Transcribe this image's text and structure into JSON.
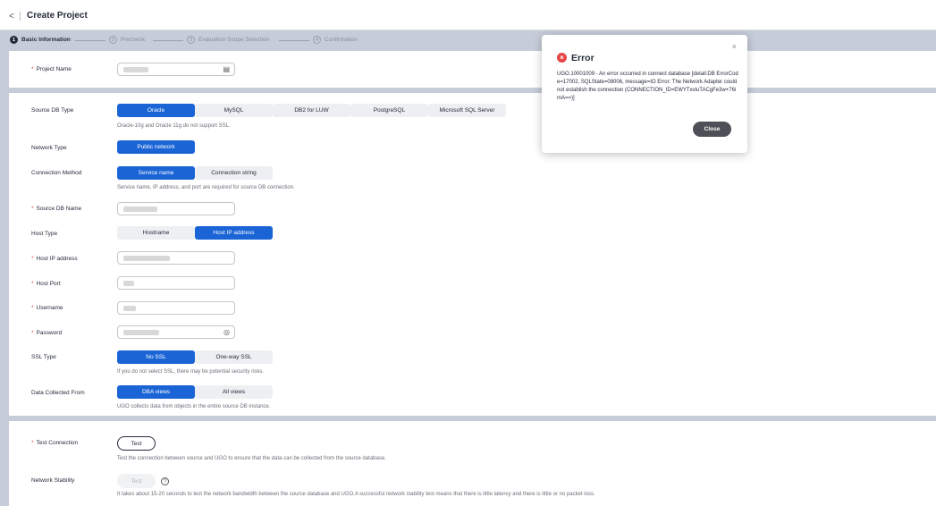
{
  "header": {
    "back_icon": "chevron-left-icon",
    "back_glyph": "<",
    "title": "Create Project"
  },
  "steps": [
    {
      "num": "1",
      "label": "Basic Information"
    },
    {
      "num": "2",
      "label": "Precheck"
    },
    {
      "num": "3",
      "label": "Evaluation Scope Selection"
    },
    {
      "num": "4",
      "label": "Confirmation"
    }
  ],
  "form": {
    "project_name_label": "Project Name",
    "source_db_type_label": "Source DB Type",
    "db_types": [
      "Oracle",
      "MySQL",
      "DB2 for LUW",
      "PostgreSQL",
      "Microsoft SQL Server"
    ],
    "db_type_selected": "Oracle",
    "db_type_hint": "Oracle-10g and Oracle 11g do not support SSL.",
    "network_type_label": "Network Type",
    "network_type_value": "Public network",
    "connection_method_label": "Connection Method",
    "connection_methods": [
      "Service name",
      "Connection string"
    ],
    "connection_hint": "Service name, IP address, and port are required for source DB connection.",
    "source_db_name_label": "Source DB Name",
    "host_type_label": "Host Type",
    "host_types": [
      "Hostname",
      "Host IP address"
    ],
    "host_ip_label": "Host IP address",
    "host_port_label": "Host Port",
    "username_label": "Username",
    "password_label": "Password",
    "ssl_type_label": "SSL Type",
    "ssl_types": [
      "No SSL",
      "One-way SSL"
    ],
    "ssl_hint": "If you do not select SSL, there may be potential security risks.",
    "data_collected_label": "Data Collected From",
    "data_collected": [
      "DBA views",
      "All views"
    ],
    "data_collected_hint": "UGO collects data from objects in the entire source DB instance."
  },
  "test": {
    "test_connection_label": "Test Connection",
    "test_button": "Test",
    "test_connection_hint": "Test the connection between source and UGO to ensure that the data can be collected from the source database.",
    "network_stability_label": "Network Stability",
    "stability_button": "Test",
    "help_glyph": "?",
    "stability_hint": "It takes about 15-20 seconds to test the network bandwidth between the source database and UGO.A successful network stability test means that there is little latency and there is little or no packet loss."
  },
  "modal": {
    "title": "Error",
    "close_glyph": "×",
    "error_glyph": "×",
    "message": "UGO.10001009 - An error occurred in connect database [detail:DB ErrorCode=17002, SQLState=08006, message=IO Error: The Network Adapter could not establish the connection (CONNECTION_ID=EWYTxvluTACgFe3w+76imA==)]",
    "close_button": "Close"
  },
  "colors": {
    "primary": "#1a64d6",
    "required": "#e54545",
    "error": "#e54545"
  }
}
